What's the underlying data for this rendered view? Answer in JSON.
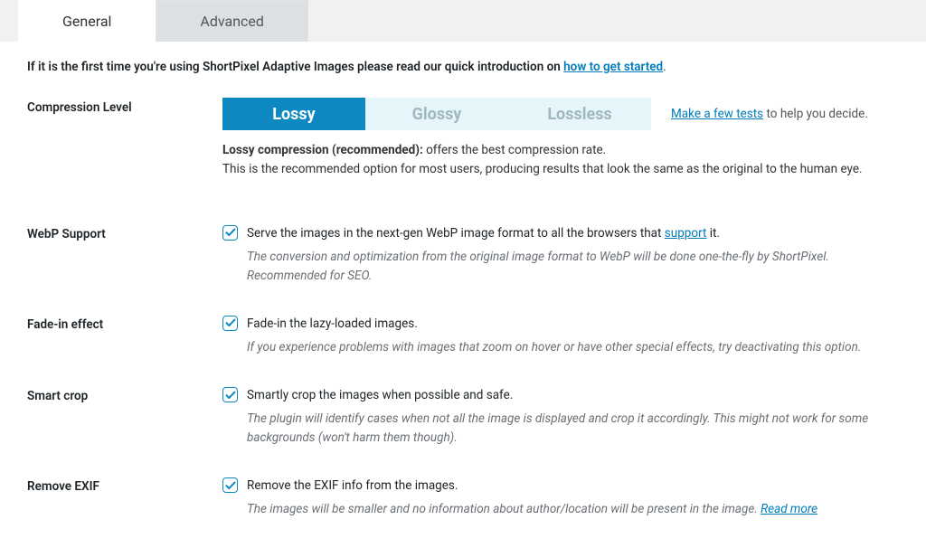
{
  "tabs": {
    "general": "General",
    "advanced": "Advanced"
  },
  "intro": {
    "prefix": "If it is the first time you're using ShortPixel Adaptive Images please read our quick introduction on ",
    "link": "how to get started",
    "suffix": "."
  },
  "compression": {
    "label": "Compression Level",
    "options": {
      "lossy": "Lossy",
      "glossy": "Glossy",
      "lossless": "Lossless"
    },
    "help_link": "Make a few tests",
    "help_suffix": " to help you decide.",
    "desc_bold": "Lossy compression (recommended):",
    "desc_rest": " offers the best compression rate.",
    "desc_line2": "This is the recommended option for most users, producing results that look the same as the original to the human eye."
  },
  "webp": {
    "label": "WebP Support",
    "check_pre": "Serve the images in the next-gen WebP image format to all the browsers that ",
    "check_link": "support",
    "check_post": " it.",
    "hint": "The conversion and optimization from the original image format to WebP will be done one-the-fly by ShortPixel. Recommended for SEO."
  },
  "fadein": {
    "label": "Fade-in effect",
    "check": "Fade-in the lazy-loaded images.",
    "hint": "If you experience problems with images that zoom on hover or have other special effects, try deactivating this option."
  },
  "smartcrop": {
    "label": "Smart crop",
    "check": "Smartly crop the images when possible and safe.",
    "hint": "The plugin will identify cases when not all the image is displayed and crop it accordingly. This might not work for some backgrounds (won't harm them though)."
  },
  "exif": {
    "label": "Remove EXIF",
    "check": "Remove the EXIF info from the images.",
    "hint_pre": "The images will be smaller and no information about author/location will be present in the image. ",
    "hint_link": "Read more"
  }
}
